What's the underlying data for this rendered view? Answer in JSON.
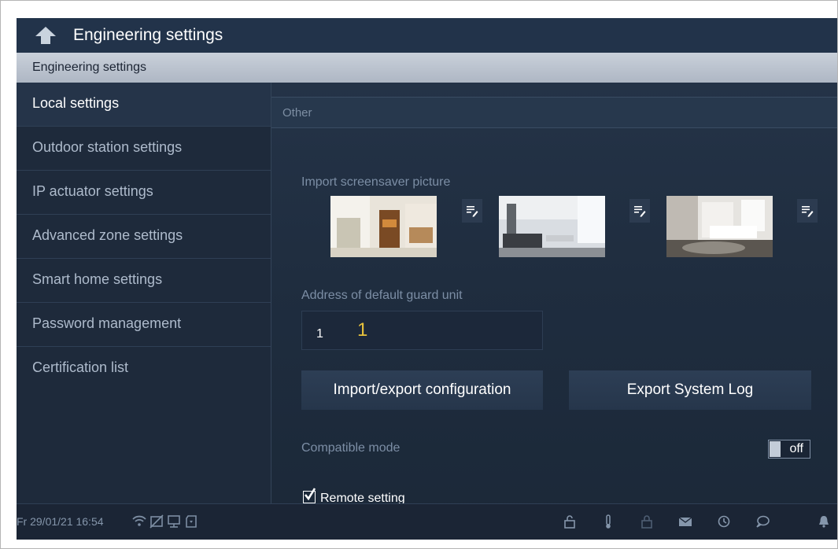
{
  "app": {
    "title": "Engineering settings"
  },
  "section": {
    "title": "Engineering settings"
  },
  "sidebar": {
    "items": [
      {
        "label": "Local settings",
        "active": true
      },
      {
        "label": "Outdoor station settings"
      },
      {
        "label": "IP actuator settings"
      },
      {
        "label": "Advanced zone settings"
      },
      {
        "label": "Smart home settings"
      },
      {
        "label": "Password management"
      },
      {
        "label": "Certification list"
      }
    ]
  },
  "content": {
    "subheader": "Other",
    "screensaver": {
      "label": "Import screensaver picture"
    },
    "guard": {
      "label": "Address of default guard unit",
      "field_label": "1",
      "value": "1"
    },
    "buttons": {
      "import_export": "Import/export configuration",
      "export_log": "Export System Log"
    },
    "compatible_mode": {
      "label": "Compatible mode",
      "state": "off"
    },
    "remote_setting": {
      "label": "Remote setting",
      "checked": true
    }
  },
  "statusbar": {
    "datetime": "Fr 29/01/21  16:54"
  },
  "colors": {
    "accent": "#e8c23c",
    "background": "#1f2d3f",
    "header_bar": "#aeb7c4"
  }
}
